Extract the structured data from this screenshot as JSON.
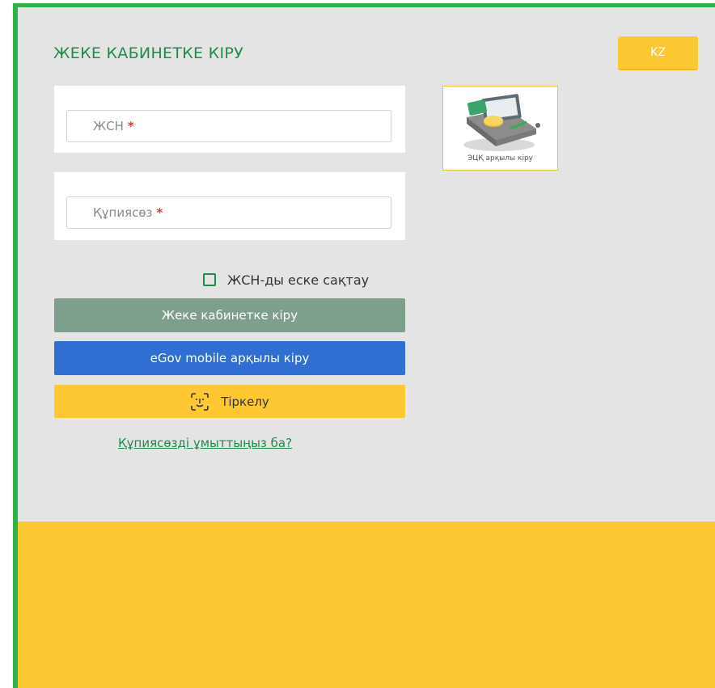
{
  "header": {
    "title": "ЖЕКЕ КАБИНЕТКЕ КІРУ",
    "lang_label": "KZ"
  },
  "form": {
    "iin_placeholder": "ЖСН",
    "password_placeholder": "Құпиясөз",
    "required_mark": "*",
    "remember_label": "ЖСН-ды еске сақтау",
    "remember_checked": false
  },
  "ecp": {
    "label": "ЭЦҚ арқылы кіру",
    "icon": "ecp-card-reader-icon"
  },
  "buttons": {
    "login_label": "Жеке кабинетке кіру",
    "egov_label": "eGov mobile арқылы кіру",
    "register_label": "Тіркелу",
    "register_icon": "face-id-icon"
  },
  "links": {
    "forgot_password": "Құпиясөзді ұмыттыңыз ба?"
  },
  "colors": {
    "green": "#1e8a4b",
    "yellow": "#fdc832",
    "blue": "#2f6fd1",
    "disabled_green": "#7f9f8d",
    "panel_gray": "#e4e4e4"
  }
}
